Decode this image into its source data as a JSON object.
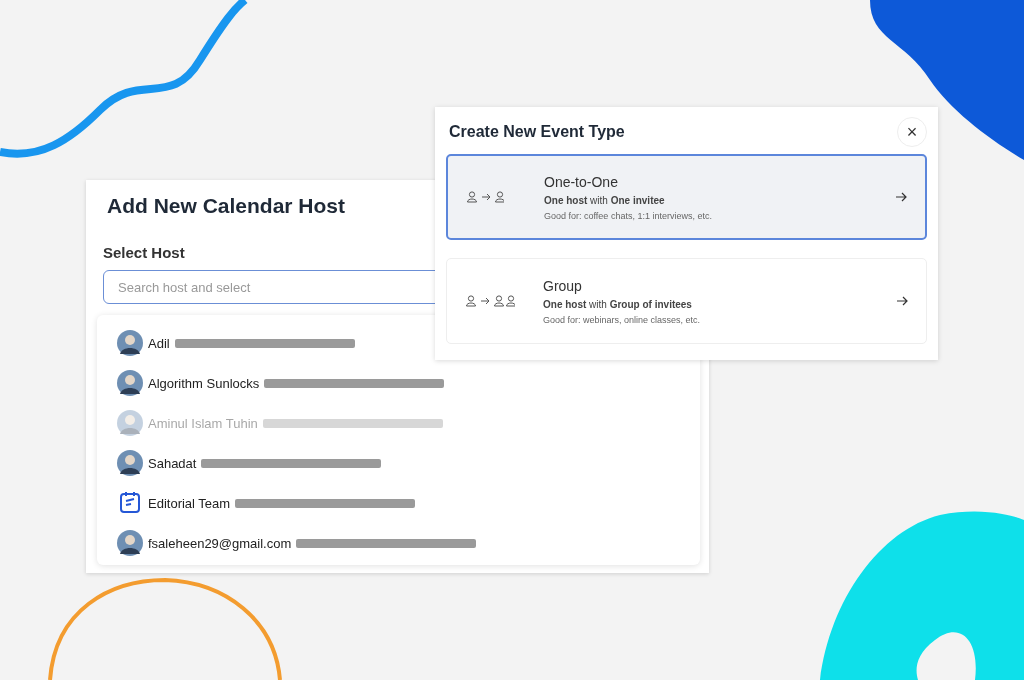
{
  "host_dialog": {
    "title": "Add New Calendar Host",
    "field_label": "Select Host",
    "search": {
      "placeholder": "Search host and select"
    },
    "options": [
      {
        "name": "Adil",
        "kind": "person",
        "disabled": false
      },
      {
        "name": "Algorithm Sunlocks",
        "kind": "person",
        "disabled": false
      },
      {
        "name": "Aminul Islam Tuhin",
        "kind": "person",
        "disabled": true
      },
      {
        "name": "Sahadat",
        "kind": "person",
        "disabled": false
      },
      {
        "name": "Editorial Team",
        "kind": "team",
        "disabled": false
      },
      {
        "name": "fsaleheen29@gmail.com",
        "kind": "person",
        "disabled": false
      }
    ]
  },
  "event_dialog": {
    "title": "Create New Event Type",
    "close": "×",
    "types": [
      {
        "title": "One-to-One",
        "kind": "single",
        "summary": "**One host** with **One invitee**",
        "good_for": "Good for: coffee chats, 1:1 interviews, etc.",
        "selected": true
      },
      {
        "title": "Group",
        "kind": "group",
        "summary": "**One host** with **Group of invitees**",
        "good_for": "Good for: webinars, online classes, etc.",
        "selected": false
      }
    ]
  }
}
